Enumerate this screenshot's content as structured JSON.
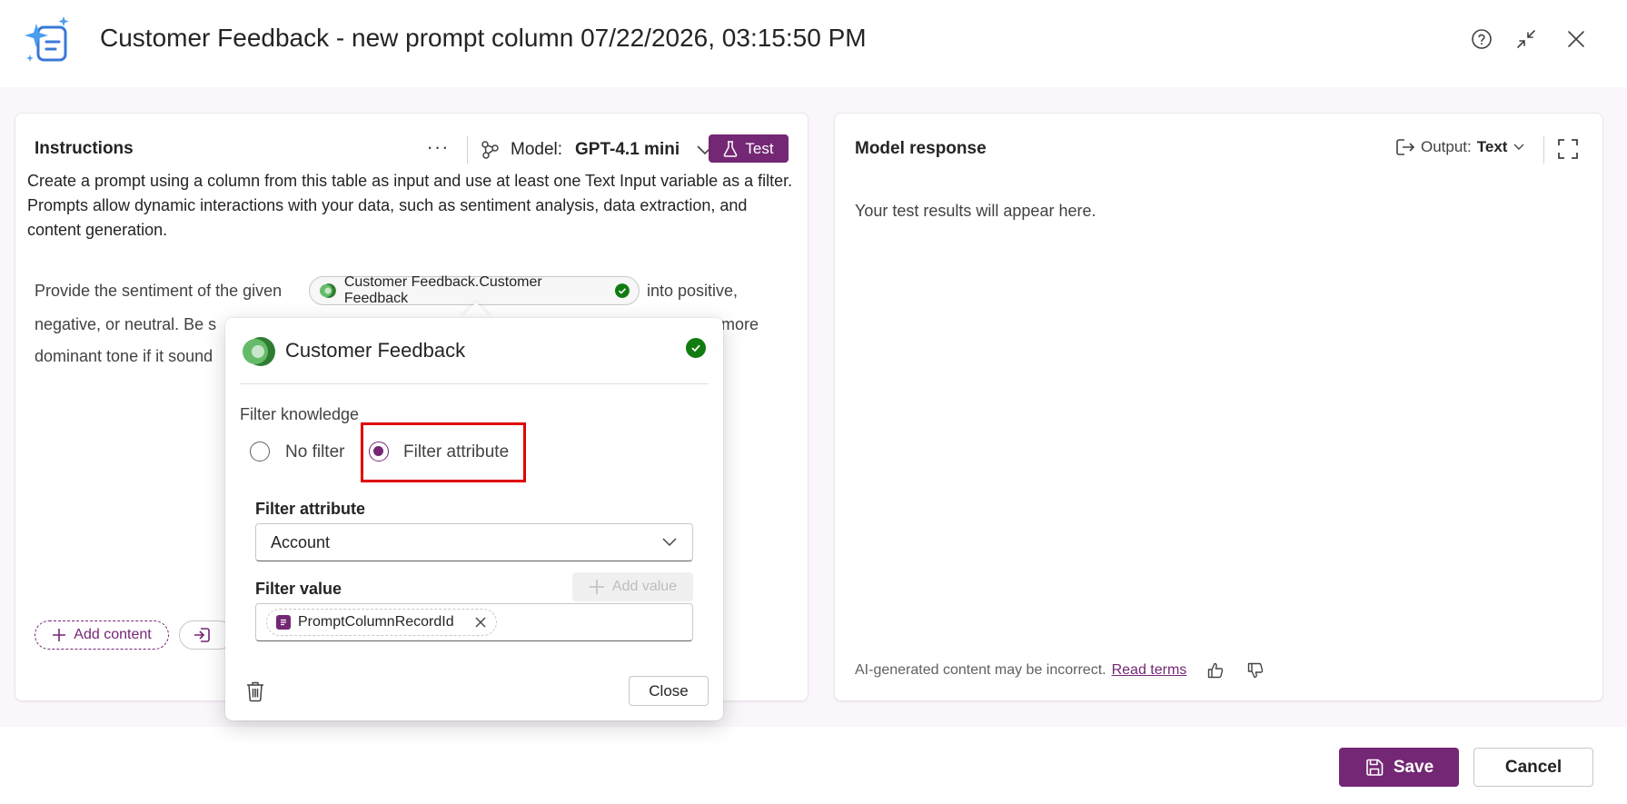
{
  "header": {
    "title": "Customer Feedback - new prompt column 07/22/2026, 03:15:50 PM",
    "icons": [
      "help-icon",
      "minimize-icon",
      "close-icon"
    ]
  },
  "instructions": {
    "title": "Instructions",
    "more_label": "···",
    "model_label": "Model:",
    "model_value": "GPT-4.1 mini",
    "test_label": "Test",
    "description": "Create a prompt using a column from this table as input and use at least one Text Input variable as a filter. Prompts allow dynamic interactions with your data, such as sentiment analysis, data extraction, and content generation.",
    "prompt_line1_start": "Provide the sentiment of the given",
    "prompt_chip": "Customer Feedback.Customer Feedback",
    "prompt_line1_end": "into positive,",
    "prompt_line2_start": "negative, or neutral. Be s",
    "prompt_line2_end": "more",
    "prompt_line3_start": "dominant tone if it sound",
    "add_content": "Add content"
  },
  "response": {
    "title": "Model response",
    "output_label": "Output:",
    "output_value": "Text",
    "placeholder": "Your test results will appear here.",
    "disclaimer": "AI-generated content may be incorrect.",
    "read_terms": "Read terms"
  },
  "popup": {
    "title": "Customer Feedback",
    "filter_knowledge": "Filter knowledge",
    "options": [
      "No filter",
      "Filter attribute"
    ],
    "selected_option": "Filter attribute",
    "filter_attribute_label": "Filter attribute",
    "filter_attribute_value": "Account",
    "filter_value_label": "Filter value",
    "add_value": "Add value",
    "value_chip": "PromptColumnRecordId",
    "close": "Close"
  },
  "footer": {
    "save": "Save",
    "cancel": "Cancel"
  },
  "colors": {
    "accent": "#742774",
    "success": "#107c10",
    "highlight": "#e00000"
  }
}
